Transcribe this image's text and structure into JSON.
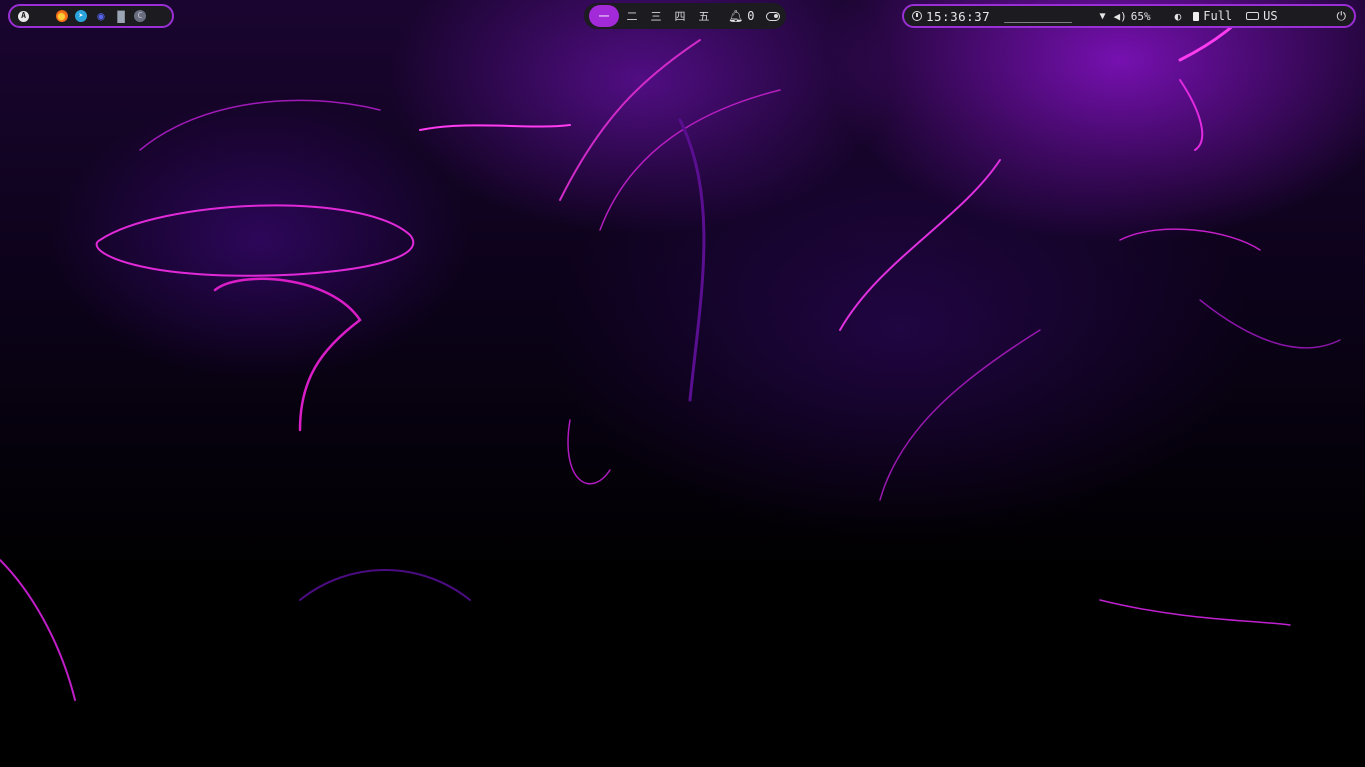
{
  "launcher": {
    "apps": [
      {
        "name": "arch-menu-icon",
        "glyph": "A"
      },
      {
        "name": "firefox-icon",
        "glyph": ""
      },
      {
        "name": "telegram-icon",
        "glyph": "➤"
      },
      {
        "name": "discord-icon",
        "glyph": "◉"
      },
      {
        "name": "folder-icon",
        "glyph": "▇"
      },
      {
        "name": "code-editor-icon",
        "glyph": "C"
      }
    ]
  },
  "workspaces": {
    "items": [
      "一",
      "二",
      "三",
      "四",
      "五"
    ],
    "active_index": 0,
    "notification_count": "0"
  },
  "status": {
    "time": "15:36:37",
    "media": "__________",
    "volume": "65%",
    "battery": "Full",
    "keyboard_layout": "US"
  },
  "colors": {
    "accent": "#a22ad8",
    "bar_background": "#1c1b20",
    "border": "#9b2fd6"
  }
}
